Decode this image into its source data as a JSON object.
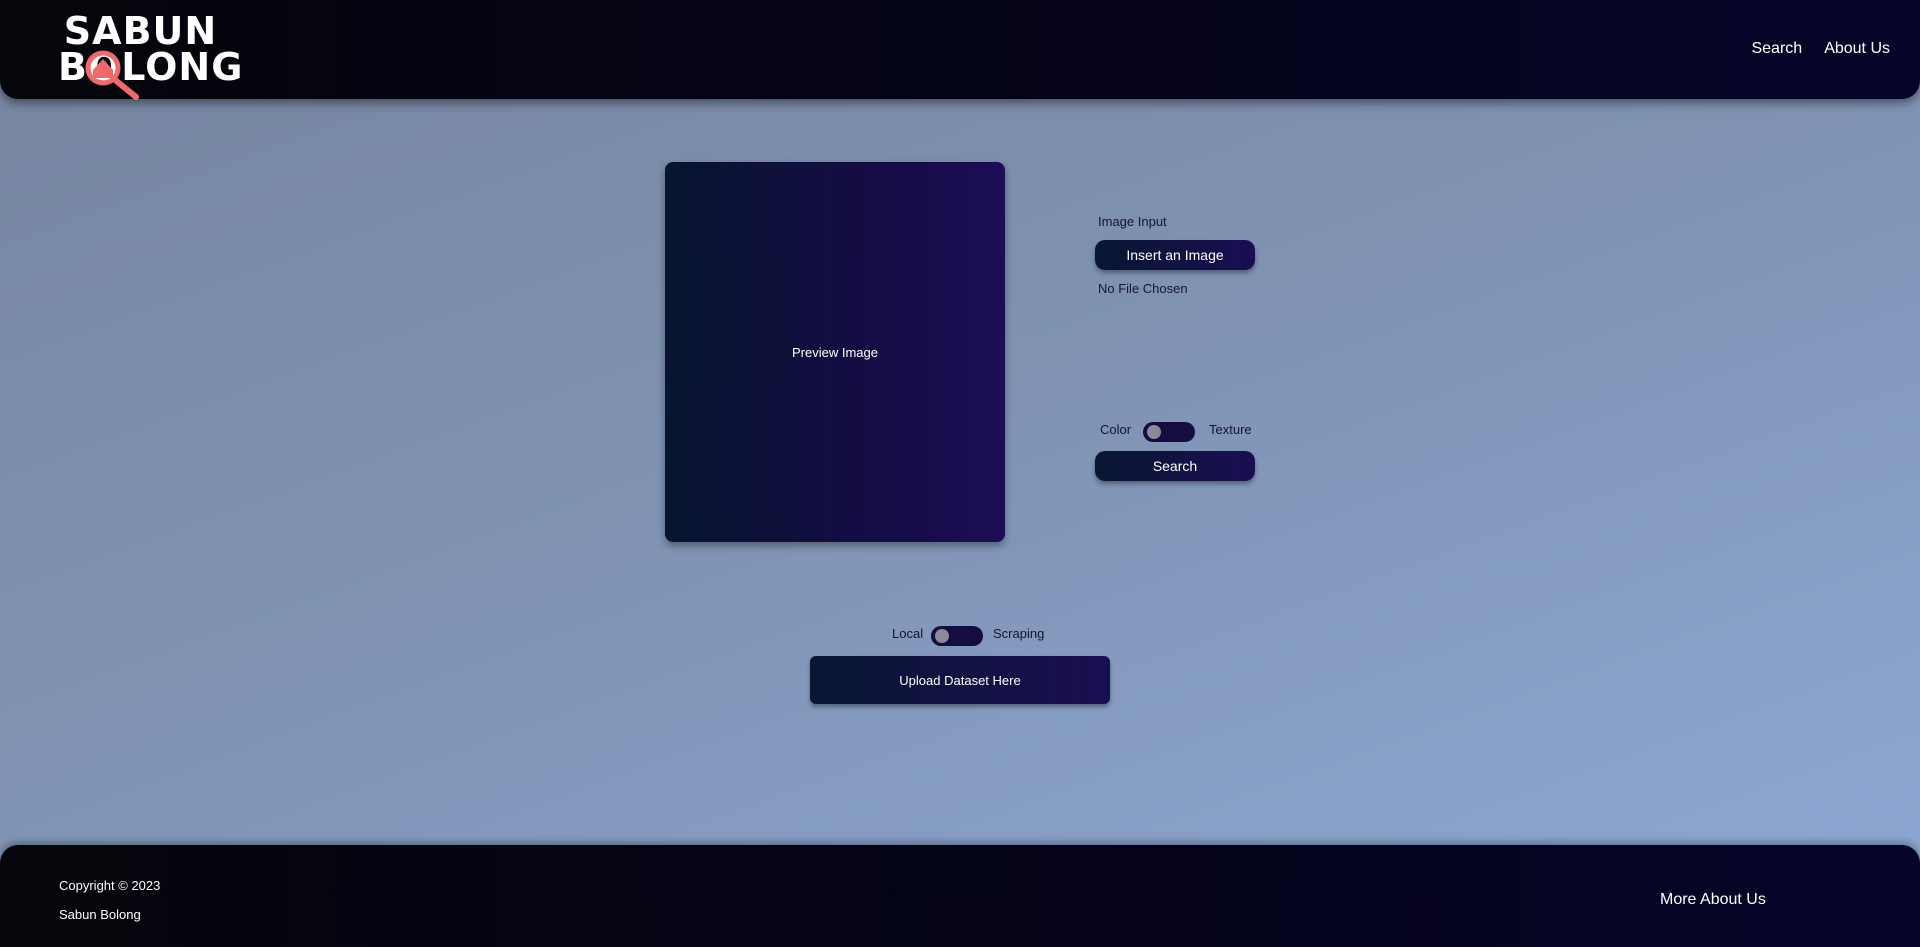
{
  "brand": {
    "logo_line1": "SABUN",
    "logo_line2": "BOLONG",
    "logo_accent_color": "#f06a6a",
    "logo_icon": "magnifier-house-icon"
  },
  "nav": {
    "items": [
      {
        "label": "Search"
      },
      {
        "label": "About Us"
      }
    ]
  },
  "preview": {
    "label": "Preview Image"
  },
  "image_input": {
    "label": "Image Input",
    "button_label": "Insert an Image",
    "file_status": "No File Chosen"
  },
  "search_mode": {
    "left_label": "Color",
    "right_label": "Texture",
    "state": "Color",
    "button_label": "Search"
  },
  "dataset": {
    "left_label": "Local",
    "right_label": "Scraping",
    "state": "Local",
    "button_label": "Upload Dataset Here"
  },
  "footer": {
    "copyright": "Copyright © 2023",
    "company": "Sabun Bolong",
    "link_label": "More About Us"
  }
}
